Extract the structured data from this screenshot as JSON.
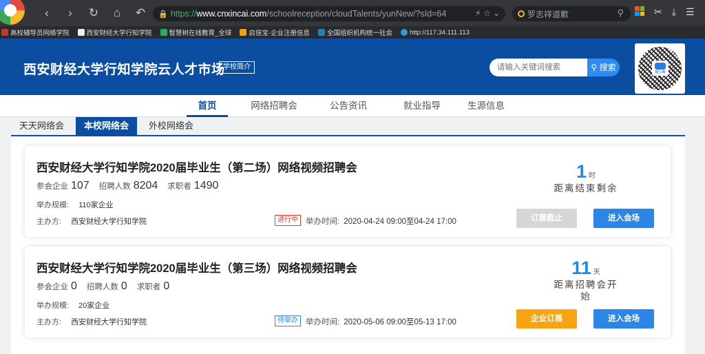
{
  "browser": {
    "url_proto": "https://",
    "url_host": "www.cnxincai.com",
    "url_path": "/schoolreception/cloudTalents/yunNew/?sId=64",
    "search_text": "罗志祥道歉"
  },
  "bookmarks": [
    {
      "label": "高校辅导员网络学院",
      "color": "#c0392b"
    },
    {
      "label": "西安财经大学行知学院",
      "color": "#eeeeee"
    },
    {
      "label": "智慧树在线教育_全球",
      "color": "#27ae60"
    },
    {
      "label": "启信宝-企业注册信息",
      "color": "#f39c12"
    },
    {
      "label": "全国组织机构统一社会",
      "color": "#2980b9"
    },
    {
      "label": "http://117.34.111.113",
      "color": "#3498db"
    }
  ],
  "header": {
    "title": "西安财经大学行知学院云人才市场",
    "intro_label": "学校简介",
    "search_placeholder": "请输入关键词搜索",
    "search_button": "搜索",
    "qr_brand": "猫头鹰"
  },
  "nav": [
    {
      "label": "首页",
      "active": true
    },
    {
      "label": "网络招聘会",
      "active": false
    },
    {
      "label": "公告资讯",
      "active": false
    },
    {
      "label": "就业指导",
      "active": false
    },
    {
      "label": "生源信息",
      "active": false
    }
  ],
  "tabs": [
    {
      "label": "天天网络会",
      "active": false
    },
    {
      "label": "本校网络会",
      "active": true
    },
    {
      "label": "外校网络会",
      "active": false
    }
  ],
  "labels": {
    "companies": "参会企业",
    "positions": "招聘人数",
    "seekers": "求职者",
    "scale": "举办规模:",
    "organizer": "主办方:",
    "time": "举办时间:"
  },
  "fairs": [
    {
      "title": "西安财经大学行知学院2020届毕业生（第二场）网络视频招聘会",
      "companies": "107",
      "positions": "8204",
      "seekers": "1490",
      "scale": "110家企业",
      "organizer": "西安财经大学行知学院",
      "status": "进行中",
      "time": "2020-04-24 09:00至04-24 17:00",
      "countdown_num": "1",
      "countdown_unit": "时",
      "countdown_label": "距离结束剩余",
      "left_button": "订展截止",
      "left_button_style": "disabled",
      "enter_button": "进入会场"
    },
    {
      "title": "西安财经大学行知学院2020届毕业生（第三场）网络视频招聘会",
      "companies": "0",
      "positions": "0",
      "seekers": "0",
      "scale": "20家企业",
      "organizer": "西安财经大学行知学院",
      "status": "待举办",
      "time": "2020-05-06 09:00至05-13 17:00",
      "countdown_num": "11",
      "countdown_unit": "天",
      "countdown_label": "距离招聘会开始",
      "left_button": "企业订展",
      "left_button_style": "orange",
      "enter_button": "进入会场"
    }
  ]
}
